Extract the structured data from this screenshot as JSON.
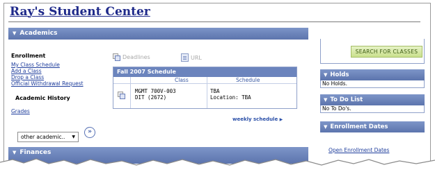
{
  "page": {
    "title": "Ray's Student Center"
  },
  "academics": {
    "header": "Academics",
    "enrollment_heading": "Enrollment",
    "links": [
      "My Class Schedule",
      "Add a Class",
      "Drop a Class",
      "Official Withdrawal Request"
    ],
    "history_heading": "Academic History",
    "grades_link": "Grades",
    "deadlines_label": "Deadlines",
    "url_label": "URL",
    "schedule": {
      "title": "Fall 2007 Schedule",
      "columns": [
        "Class",
        "Schedule"
      ],
      "row": {
        "class_line1": "MGMT 700V-003",
        "class_line2": "DIT (2672)",
        "schedule_line1": "TBA",
        "schedule_line2": "Location:  TBA"
      }
    },
    "weekly_schedule": "weekly schedule",
    "other_select": "other academic..",
    "go_button": "»"
  },
  "finances": {
    "header": "Finances"
  },
  "sidebar": {
    "search_button": "SEARCH FOR CLASSES",
    "holds": {
      "header": "Holds",
      "text": "No Holds."
    },
    "todo": {
      "header": "To Do List",
      "text": "No To Do's."
    },
    "enrollment_dates": {
      "header": "Enrollment Dates",
      "link": "Open Enrollment Dates"
    }
  },
  "colors": {
    "header_bar": "#6b84bd",
    "link": "#1e3d9c",
    "search_button": "#c9e08c"
  }
}
